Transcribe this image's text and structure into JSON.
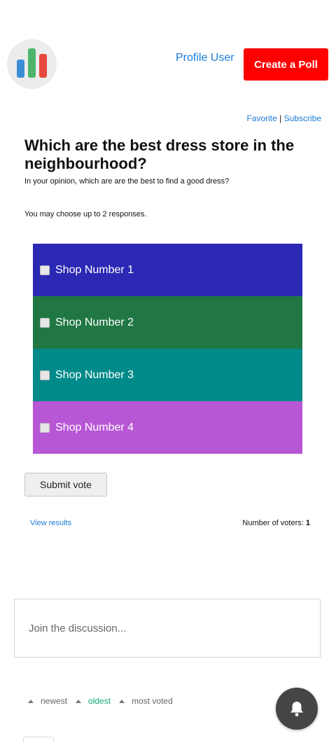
{
  "header": {
    "profile_link": "Profile User",
    "create_poll_button": "Create a Poll"
  },
  "links": {
    "favorite": "Favorite",
    "separator": "|",
    "subscribe": "Subscribe"
  },
  "poll": {
    "question": "Which are the best dress store in the neighbourhood?",
    "description": "In your opinion, which are are the best to find a good dress?",
    "choose_text": "You may choose up to 2 responses.",
    "options": [
      {
        "label": "Shop Number 1",
        "color": "#2b28b4",
        "checked": false
      },
      {
        "label": "Shop Number 2",
        "color": "#207744",
        "checked": false
      },
      {
        "label": "Shop Number 3",
        "color": "#018a8a",
        "checked": false
      },
      {
        "label": "Shop Number 4",
        "color": "#b857d6",
        "checked": false
      }
    ],
    "submit_label": "Submit vote",
    "view_results": "View results",
    "voters_label": "Number of voters:",
    "voters_count": "1"
  },
  "discussion": {
    "placeholder": "Join the discussion..."
  },
  "sort": {
    "items": [
      "newest",
      "oldest",
      "most voted"
    ],
    "active": "oldest"
  },
  "icons": {
    "logo": "bar-chart-logo",
    "notifications": "bell-icon"
  }
}
